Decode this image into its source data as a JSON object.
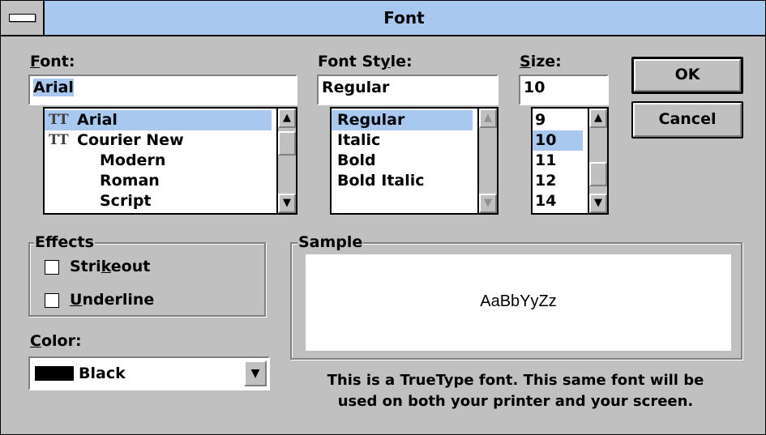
{
  "dialog": {
    "title": "Font"
  },
  "font": {
    "label_access": "F",
    "label_rest": "ont:",
    "value": "Arial",
    "items": [
      {
        "name": "Arial",
        "truetype": true,
        "selected": true
      },
      {
        "name": "Courier New",
        "truetype": true,
        "selected": false
      },
      {
        "name": "Modern",
        "truetype": false,
        "selected": false
      },
      {
        "name": "Roman",
        "truetype": false,
        "selected": false
      },
      {
        "name": "Script",
        "truetype": false,
        "selected": false
      }
    ]
  },
  "style": {
    "label_pre": "Font St",
    "label_access": "y",
    "label_rest": "le:",
    "value": "Regular",
    "items": [
      "Regular",
      "Italic",
      "Bold",
      "Bold Italic"
    ]
  },
  "size": {
    "label_access": "S",
    "label_rest": "ize:",
    "value": "10",
    "items": [
      "9",
      "10",
      "11",
      "12",
      "14"
    ]
  },
  "buttons": {
    "ok": "OK",
    "cancel": "Cancel"
  },
  "effects": {
    "title": "Effects",
    "strikeout_pre": "Stri",
    "strikeout_access": "k",
    "strikeout_rest": "eout",
    "underline_access": "U",
    "underline_rest": "nderline",
    "strikeout_checked": false,
    "underline_checked": false
  },
  "color": {
    "label_access": "C",
    "label_rest": "olor:",
    "value": "Black",
    "swatch": "#000000"
  },
  "sample": {
    "title": "Sample",
    "text": "AaBbYyZz"
  },
  "info": {
    "line1": "This is a TrueType font. This same font will be",
    "line2": "used on both your printer and your screen."
  },
  "icons": {
    "truetype": "TT",
    "arrow_up": "▲",
    "arrow_down": "▼",
    "combo_arrow": "▼"
  },
  "colors": {
    "titlebar": "#a8c8f0",
    "selection": "#a8c8f0",
    "face": "#c0c0c0"
  }
}
